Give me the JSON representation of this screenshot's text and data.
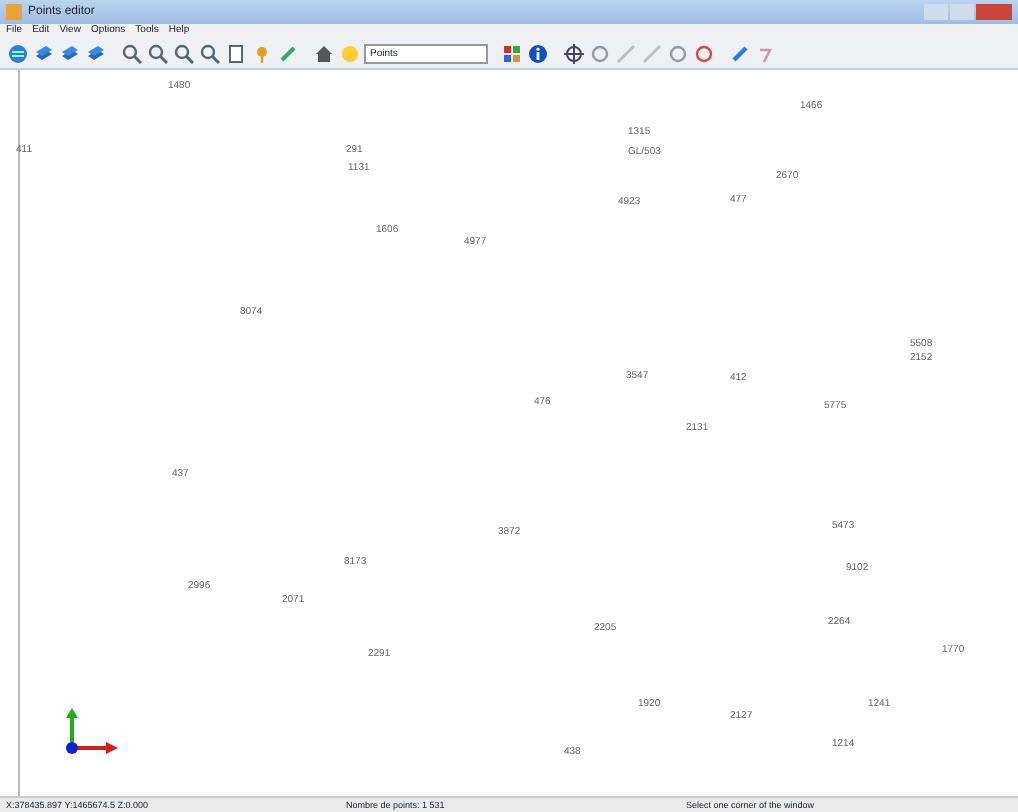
{
  "window": {
    "title": "Points editor"
  },
  "menu": [
    "File",
    "Edit",
    "View",
    "Options",
    "Tools",
    "Help"
  ],
  "toolbar": {
    "layer_select": "Points"
  },
  "points": [
    {
      "label": "1480"
    },
    {
      "label": "411"
    },
    {
      "label": "291"
    },
    {
      "label": "1131"
    },
    {
      "label": "1606"
    },
    {
      "label": "4977"
    },
    {
      "label": "8074"
    },
    {
      "label": "1466"
    },
    {
      "label": "1315"
    },
    {
      "label": "GL/503"
    },
    {
      "label": "2670"
    },
    {
      "label": "4923"
    },
    {
      "label": "477"
    },
    {
      "label": "5508"
    },
    {
      "label": "2152"
    },
    {
      "label": "3547"
    },
    {
      "label": "412"
    },
    {
      "label": "476"
    },
    {
      "label": "5775"
    },
    {
      "label": "2131"
    },
    {
      "label": "437"
    },
    {
      "label": "3872"
    },
    {
      "label": "8173"
    },
    {
      "label": "5473"
    },
    {
      "label": "9102"
    },
    {
      "label": "2996"
    },
    {
      "label": "2071"
    },
    {
      "label": "2205"
    },
    {
      "label": "2264"
    },
    {
      "label": "2291"
    },
    {
      "label": "1770"
    },
    {
      "label": "1920"
    },
    {
      "label": "2127"
    },
    {
      "label": "1241"
    },
    {
      "label": "438"
    },
    {
      "label": "1214"
    }
  ],
  "status_bar": [
    "X:378435.897 Y:1465674.5 Z:0.000",
    "Nombre de points: 1 531",
    "Select one corner of the window"
  ]
}
